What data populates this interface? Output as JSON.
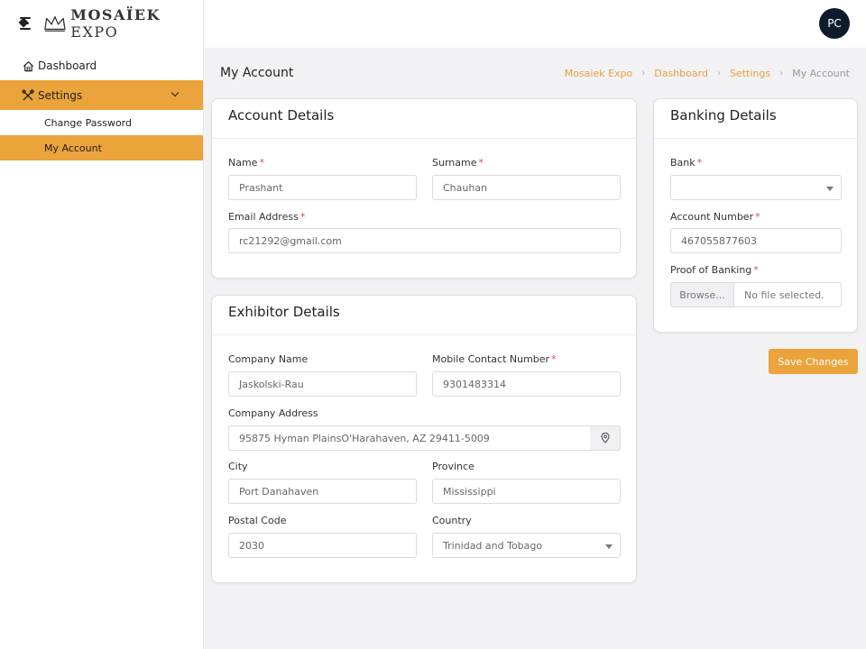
{
  "brand": {
    "name_bold": "MOSAÏEK",
    "name_light": " EXPO"
  },
  "sidebar": {
    "items": [
      {
        "label": "Dashboard"
      },
      {
        "label": "Settings"
      }
    ],
    "subitems": [
      {
        "label": "Change Password"
      },
      {
        "label": "My Account"
      }
    ]
  },
  "user": {
    "initials": "PC"
  },
  "page": {
    "title": "My Account"
  },
  "breadcrumb": [
    "Mosaiek Expo",
    "Dashboard",
    "Settings",
    "My Account"
  ],
  "account": {
    "title": "Account Details",
    "name_label": "Name",
    "name_value": "Prashant",
    "surname_label": "Surname",
    "surname_value": "Chauhan",
    "email_label": "Email Address",
    "email_value": "rc21292@gmail.com"
  },
  "exhibitor": {
    "title": "Exhibitor Details",
    "company_label": "Company Name",
    "company_value": "Jaskolski-Rau",
    "mobile_label": "Mobile Contact Number",
    "mobile_value": "9301483314",
    "address_label": "Company Address",
    "address_value": "95875 Hyman PlainsO'Harahaven, AZ 29411-5009",
    "city_label": "City",
    "city_value": "Port Danahaven",
    "province_label": "Province",
    "province_value": "Mississippi",
    "postal_label": "Postal Code",
    "postal_value": "2030",
    "country_label": "Country",
    "country_value": "Trinidad and Tobago"
  },
  "banking": {
    "title": "Banking Details",
    "bank_label": "Bank",
    "bank_value": "",
    "account_label": "Account Number",
    "account_value": "467055877603",
    "proof_label": "Proof of Banking",
    "browse_label": "Browse...",
    "file_status": "No file selected."
  },
  "actions": {
    "save_label": "Save Changes"
  },
  "colors": {
    "accent": "#eba33b",
    "required": "#e04848",
    "avatar_bg": "#0f1b2d"
  }
}
